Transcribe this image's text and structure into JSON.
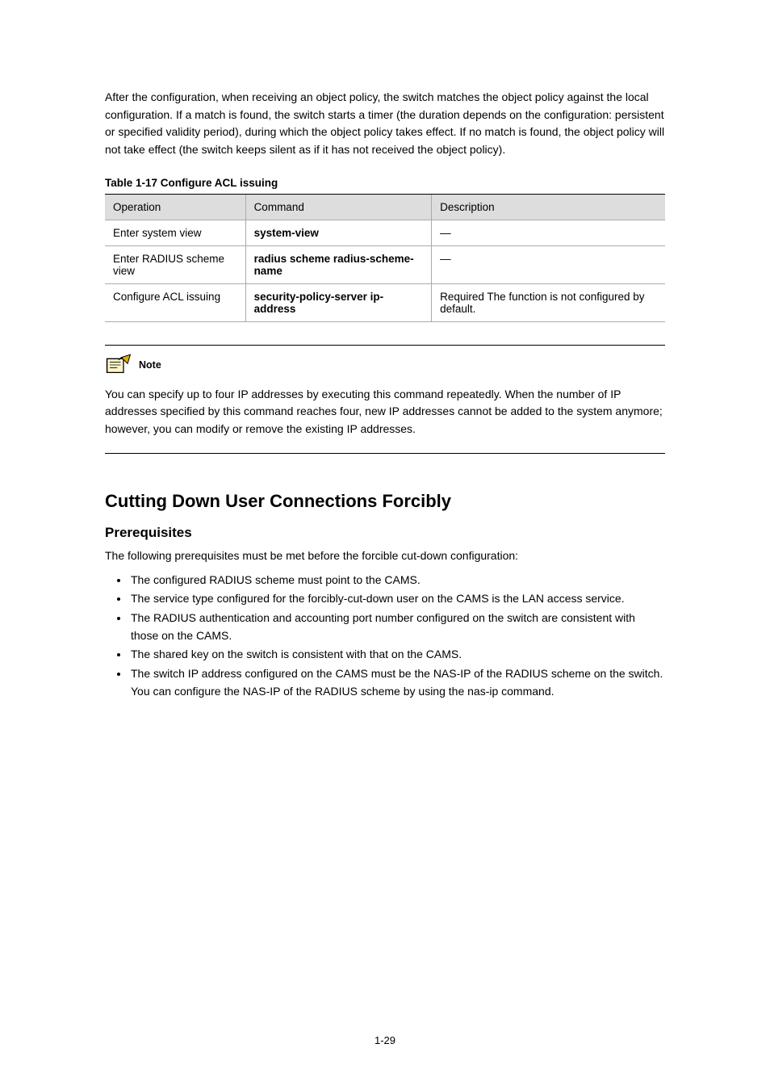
{
  "intro_text": "After the configuration, when receiving an object policy, the switch matches the object policy against the local configuration. If a match is found, the switch starts a timer (the duration depends on the configuration: persistent or specified validity period), during which the object policy takes effect. If no match is found, the object policy will not take effect (the switch keeps silent as if it has not received the object policy).",
  "table_title": "Table 1-17 Configure ACL issuing",
  "table": {
    "headers": [
      "Operation",
      "Command",
      "Description"
    ],
    "rows": [
      {
        "op": "Enter system view",
        "cmd": "system-view",
        "desc": "—"
      },
      {
        "op": "Enter RADIUS scheme view",
        "cmd": "radius scheme radius-scheme-name",
        "desc": "—"
      },
      {
        "op": "Configure ACL issuing",
        "cmd": "security-policy-server ip-address",
        "desc": "Required\nThe function is not configured by default."
      }
    ]
  },
  "note": {
    "label": "Note",
    "text": "You can specify up to four IP addresses by executing this command repeatedly. When the number of IP addresses specified by this command reaches four, new IP addresses cannot be added to the system anymore; however, you can modify or remove the existing IP addresses."
  },
  "section_title": "Cutting Down User Connections Forcibly",
  "subsection_title": "Prerequisites",
  "prereq_intro": "The following prerequisites must be met before the forcible cut-down configuration:",
  "prereqs": [
    "The configured RADIUS scheme must point to the CAMS.",
    "The service type configured for the forcibly-cut-down user on the CAMS is the LAN access service.",
    "The RADIUS authentication and accounting port number configured on the switch are consistent with those on the CAMS.",
    "The shared key on the switch is consistent with that on the CAMS.",
    "The switch IP address configured on the CAMS must be the NAS-IP of the RADIUS scheme on the switch. You can configure the NAS-IP of the RADIUS scheme by using the nas-ip command."
  ],
  "page_number": "1-29"
}
